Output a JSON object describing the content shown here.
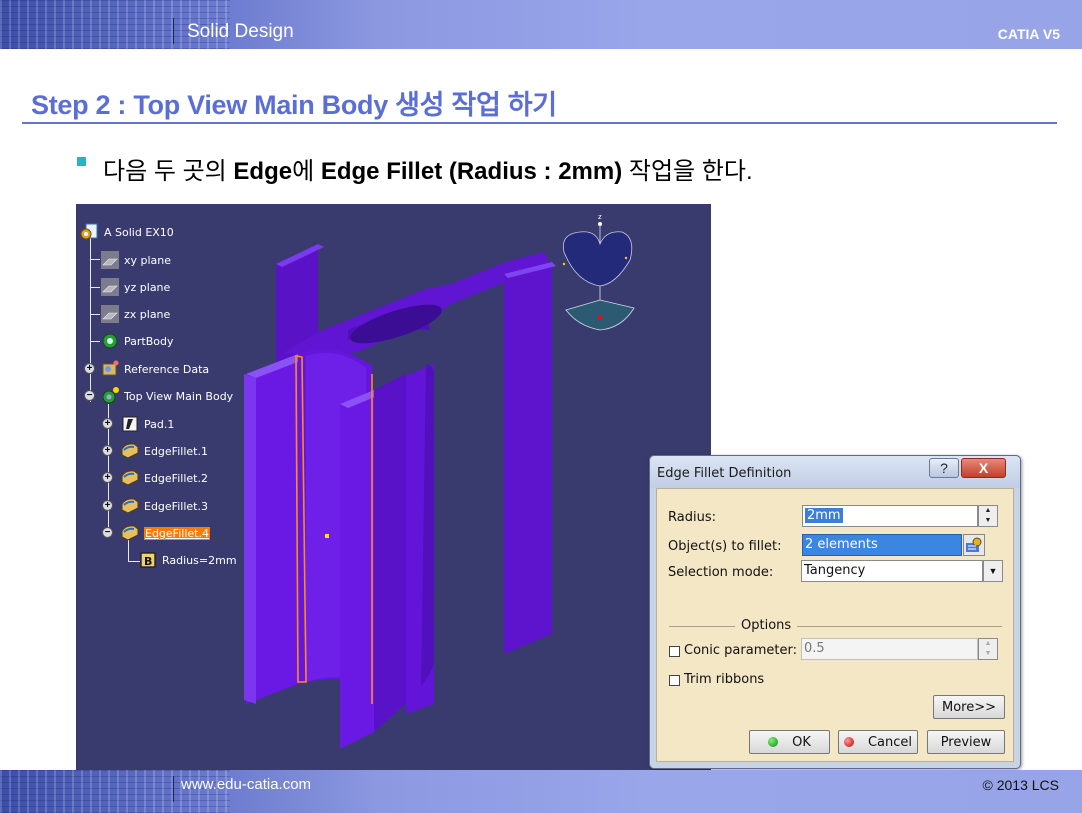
{
  "header": {
    "title": "Solid Design",
    "brand": "CATIA V5"
  },
  "step_title": "Step 2 : Top View Main Body 생성 작업 하기",
  "instruction": {
    "pre": "다음 두 곳의 ",
    "bold1": "Edge",
    "mid1": "에 ",
    "bold2": "Edge Fillet (Radius : 2mm)",
    "post": " 작업을 한다."
  },
  "tree": {
    "root": "A Solid EX10",
    "items": [
      {
        "label": "xy plane"
      },
      {
        "label": "yz plane"
      },
      {
        "label": "zx plane"
      },
      {
        "label": "PartBody"
      },
      {
        "label": "Reference Data"
      },
      {
        "label": "Top View Main Body"
      },
      {
        "label": "Pad.1"
      },
      {
        "label": "EdgeFillet.1"
      },
      {
        "label": "EdgeFillet.2"
      },
      {
        "label": "EdgeFillet.3"
      },
      {
        "label": "EdgeFillet.4"
      },
      {
        "label": "Radius=2mm"
      }
    ]
  },
  "compass_axis": "z",
  "dialog": {
    "title": "Edge Fillet Definition",
    "help": "?",
    "close": "X",
    "radius_label": "Radius:",
    "radius_value": "2mm",
    "objects_label": "Object(s) to fillet:",
    "objects_value": "2 elements",
    "selection_label": "Selection mode:",
    "selection_value": "Tangency",
    "options_label": "Options",
    "conic_label": "Conic parameter:",
    "conic_value": "0.5",
    "trim_label": "Trim ribbons",
    "more": "More>>",
    "ok": "OK",
    "cancel": "Cancel",
    "preview": "Preview"
  },
  "footer": {
    "url": "www.edu-catia.com",
    "copyright": "© 2013 LCS"
  },
  "colors": {
    "accent": "#5a6ed6",
    "model": "#6b17e6",
    "viewport": "#393b6e",
    "dialog_body": "#f4e7c5",
    "selection": "#ff7a00"
  }
}
